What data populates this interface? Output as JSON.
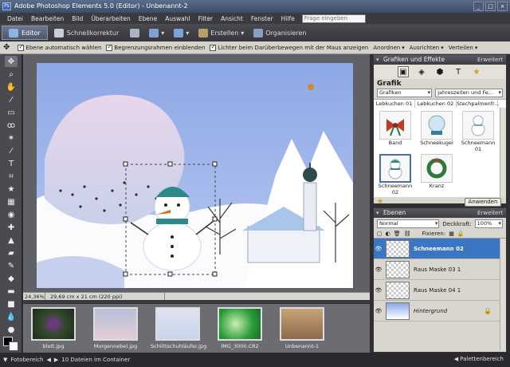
{
  "window": {
    "title": "Adobe Photoshop Elements 5.0 (Editor) - Unbenannt-2",
    "app_icon": "Ps"
  },
  "menu": {
    "items": [
      "Datei",
      "Bearbeiten",
      "Bild",
      "Überarbeiten",
      "Ebene",
      "Auswahl",
      "Filter",
      "Ansicht",
      "Fenster",
      "Hilfe"
    ],
    "help_placeholder": "Frage eingeben"
  },
  "modes": {
    "editor": "Editor",
    "quickfix": "Schnellkorrektur",
    "create": "Erstellen",
    "organize": "Organisieren"
  },
  "options": {
    "auto_select": "Ebene automatisch wählen",
    "bounding_box": "Begrenzungsrahmen einblenden",
    "highlight": "Lichter beim Darüberbewegen mit der Maus anzeigen",
    "arrange": "Anordnen",
    "align": "Ausrichten",
    "distribute": "Verteilen"
  },
  "status": {
    "zoom": "24,36%",
    "docinfo": "29,69 cm x 21 cm (220 ppi)"
  },
  "bin": {
    "thumbs": [
      {
        "label": "blatt.jpg"
      },
      {
        "label": "Morgennebel.jpg"
      },
      {
        "label": "Schlittschuhläufer.jpg"
      },
      {
        "label": "IMG_3000.CR2"
      },
      {
        "label": "Unbenannt-1"
      }
    ]
  },
  "footer": {
    "photobin": "Fotobereich",
    "count": "10 Dateien im Container",
    "palette": "Palettenbereich"
  },
  "effects": {
    "header": "Grafiken und Effekte",
    "more": "Erweitert",
    "heading": "Grafik",
    "drop1": "Grafiken",
    "drop2": "Jahreszeiten und Fe...",
    "cols": [
      "Lebkuchen 01",
      "Lebkuchen 02",
      "Stechpalmenfr..."
    ],
    "cells": [
      "Band",
      "Schneekugel",
      "Schneemann 01",
      "Schneemann 02",
      "Kranz"
    ],
    "apply": "Anwenden"
  },
  "layers": {
    "header": "Ebenen",
    "more": "Erweitert",
    "blend": "Normal",
    "opacity_label": "Deckkraft:",
    "opacity": "100%",
    "lock_label": "Fixieren:",
    "items": [
      {
        "name": "Schneemann 02"
      },
      {
        "name": "Raus Maske 03 1"
      },
      {
        "name": "Raus Maske 04 1"
      },
      {
        "name": "Hintergrund"
      }
    ]
  },
  "colors": {
    "accent": "#3a76c2",
    "selection": "#3a76c2"
  }
}
